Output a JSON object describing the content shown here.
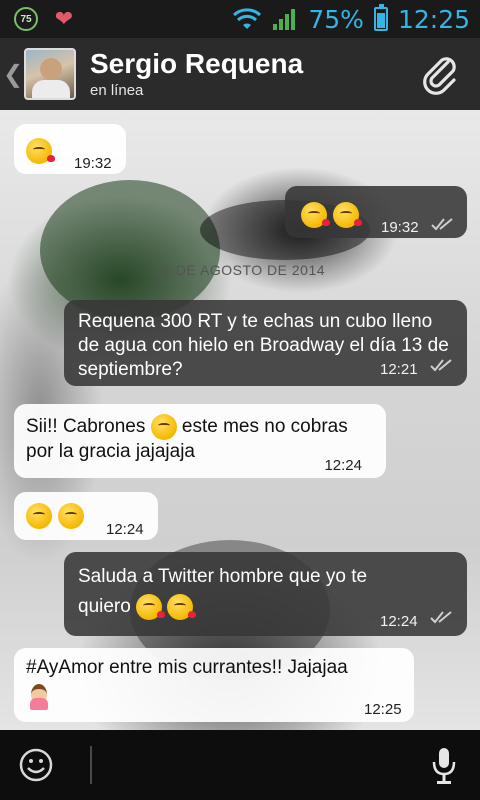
{
  "status_bar": {
    "badge_text": "75",
    "battery_percent": "75%",
    "time": "12:25",
    "battery_level": 0.75,
    "accent_color": "#33b5e5"
  },
  "header": {
    "contact_name": "Sergio Requena",
    "contact_status": "en línea",
    "icons": [
      "back-chevron-icon",
      "avatar",
      "paperclip-icon"
    ]
  },
  "messages": [
    {
      "direction": "in",
      "time": "19:32",
      "emojis": [
        "kiss-emoji"
      ]
    },
    {
      "direction": "out",
      "time": "19:32",
      "emojis": [
        "kiss-emoji",
        "kiss-emoji"
      ],
      "ticks": "double"
    },
    {
      "direction": "out",
      "text": "Requena 300 RT y te echas un cubo lleno de agua con hielo en Broadway el día 13 de septiembre?",
      "time": "12:21",
      "ticks": "double"
    },
    {
      "direction": "in",
      "text_a": "Sii!! Cabrones",
      "text_b": "este mes no cobras por la gracia jajajaja",
      "time": "12:24",
      "emojis": [
        "unamused-emoji"
      ]
    },
    {
      "direction": "in",
      "time": "12:24",
      "emojis": [
        "tongue-emoji",
        "tongue-emoji"
      ]
    },
    {
      "direction": "out",
      "text": "Saluda a Twitter hombre que yo te quiero",
      "time": "12:24",
      "emojis": [
        "kiss-emoji",
        "kiss-emoji"
      ],
      "ticks": "double"
    },
    {
      "direction": "in",
      "text": "#AyAmor entre mis currantes!! Jajajaa",
      "time": "12:25",
      "emojis": [
        "raising-hand-girl-emoji"
      ]
    }
  ],
  "date_divider": "27 DE AGOSTO DE 2014",
  "input_bar": {
    "icons": [
      "smiley-icon",
      "microphone-icon"
    ]
  }
}
